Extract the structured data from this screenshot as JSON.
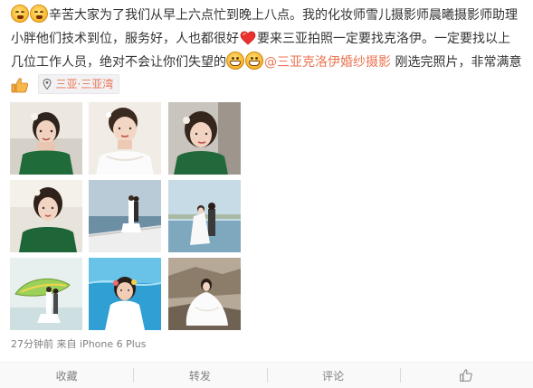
{
  "post": {
    "text_part1": "辛苦大家为了我们从早上六点忙到晚上八点。我的化妆师雪儿摄影师晨曦摄影师助理小胖他们技术到位，服务好，人也都很好",
    "text_part2": "要来三亚拍照一定要找克洛伊。一定要找以上几位工作人员，绝对不会让你们失望的",
    "mention": "@三亚克洛伊婚纱摄影",
    "text_part3": " 刚选完照片，非常满意",
    "location": "三亚·三亚湾",
    "emojis": {
      "start": "tired-face-icon",
      "heart": "heart-icon",
      "grin": "grinning-face-icon",
      "end": "thumbs-up-icon"
    }
  },
  "photos": [
    {
      "name": "photo-1",
      "desc": "bride-green-dress-closeup"
    },
    {
      "name": "photo-2",
      "desc": "bride-white-dress-closeup"
    },
    {
      "name": "photo-3",
      "desc": "bride-green-dress-portrait"
    },
    {
      "name": "photo-4",
      "desc": "bride-green-dress-wall"
    },
    {
      "name": "photo-5",
      "desc": "couple-on-yacht"
    },
    {
      "name": "photo-6",
      "desc": "couple-by-sea"
    },
    {
      "name": "photo-7",
      "desc": "couple-with-surfboard"
    },
    {
      "name": "photo-8",
      "desc": "bride-underwater"
    },
    {
      "name": "photo-9",
      "desc": "bride-on-rocks"
    }
  ],
  "meta": {
    "time": "27分钟前",
    "source_prefix": "来自",
    "device": "iPhone 6 Plus"
  },
  "actions": {
    "favorite": "收藏",
    "repost": "转发",
    "comment": "评论",
    "like_icon": "thumbs-up-icon"
  },
  "colors": {
    "link": "#eb7350",
    "text": "#333333",
    "meta": "#808080",
    "action_bg": "#f9f9f9"
  }
}
